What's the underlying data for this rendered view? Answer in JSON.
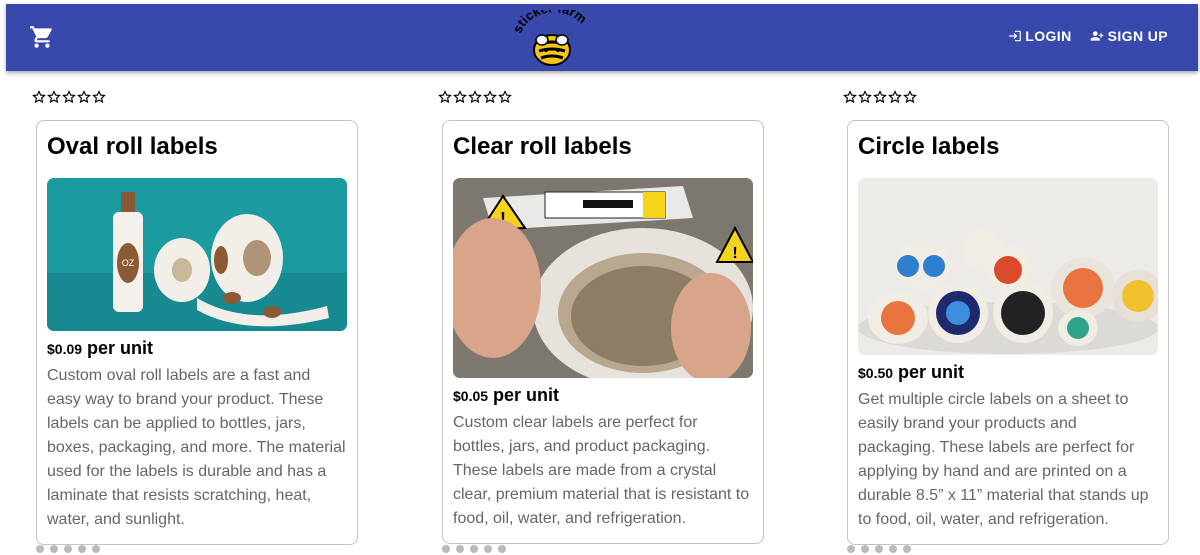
{
  "brand": {
    "logo_text": "sticker farm"
  },
  "nav": {
    "cart_icon": "shopping-cart-icon",
    "login_label": "LOGIN",
    "signup_label": "SIGN UP"
  },
  "colors": {
    "navbar": "#3949ab",
    "card_border": "#c4c4c4",
    "description_text": "#666666"
  },
  "products": [
    {
      "title": "Oval roll labels",
      "rating": 0,
      "price": "$0.09",
      "unit": " per unit",
      "description": "Custom oval roll labels are a fast and easy way to brand your product. These labels can be applied to bottles, jars, boxes, packaging, and more. The material used for the labels is durable and has a laminate that resists scratching, heat, water, and sunlight."
    },
    {
      "title": "Clear roll labels",
      "rating": 0,
      "price": "$0.05",
      "unit": " per unit",
      "description": "Custom clear labels are perfect for bottles, jars, and product packaging. These labels are made from a crystal clear, premium material that is resistant to food, oil, water, and refrigeration."
    },
    {
      "title": "Circle labels",
      "rating": 0,
      "price": "$0.50",
      "unit": " per unit",
      "description": "Get multiple circle labels on a sheet to easily brand your products and packaging. These labels are perfect for applying by hand and are printed on a durable 8.5” x 11” material that stands up to food, oil, water, and refrigeration."
    }
  ]
}
